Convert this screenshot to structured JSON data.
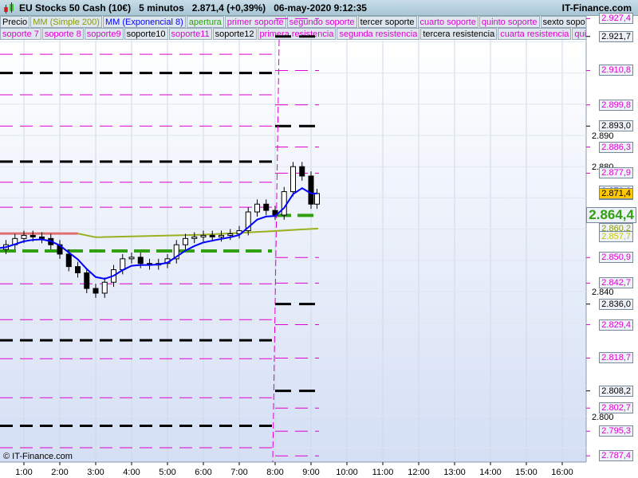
{
  "header": {
    "title": "EU Stocks 50 Cash (10€)",
    "timeframe": "5 minutos",
    "price": "2.871,4 (+0,39%)",
    "datetime": "06-may-2020 9:12:35",
    "brand": "IT-Finance.com"
  },
  "legend_row1": [
    {
      "t": "Precio",
      "c": "#000"
    },
    {
      "t": "MM (Simple 200)",
      "c": "#8a9a10"
    },
    {
      "t": "MM (Exponencial 8)",
      "c": "#0000ff"
    },
    {
      "t": "apertura",
      "c": "#30a010"
    },
    {
      "t": "primer soporte",
      "c": "#e000d0"
    },
    {
      "t": "segundo soporte",
      "c": "#e000d0"
    },
    {
      "t": "tercer soporte",
      "c": "#000"
    },
    {
      "t": "cuarto soporte",
      "c": "#e000d0"
    },
    {
      "t": "quinto soporte",
      "c": "#e000d0"
    },
    {
      "t": "sexto soporte",
      "c": "#000"
    }
  ],
  "legend_row2": [
    {
      "t": "soporte 7",
      "c": "#e000d0"
    },
    {
      "t": "soporte 8",
      "c": "#e000d0"
    },
    {
      "t": "soporte9",
      "c": "#e000d0"
    },
    {
      "t": "soporte10",
      "c": "#000"
    },
    {
      "t": "soporte11",
      "c": "#e000d0"
    },
    {
      "t": "soporte12",
      "c": "#000"
    },
    {
      "t": "primera resistencia",
      "c": "#e000d0"
    },
    {
      "t": "segunda resistencia",
      "c": "#e000d0"
    },
    {
      "t": "tercera resistencia",
      "c": "#000"
    },
    {
      "t": "cuarta resistencia",
      "c": "#e000d0"
    },
    {
      "t": "quinta resistencia",
      "c": "#e000d0"
    }
  ],
  "credit": "© IT-Finance.com",
  "chart_data": {
    "type": "candlestick",
    "x_ticks": [
      "1:00",
      "2:00",
      "3:00",
      "4:00",
      "5:00",
      "6:00",
      "7:00",
      "8:00",
      "9:00",
      "10:00",
      "11:00",
      "12:00",
      "13:00",
      "14:00",
      "15:00",
      "16:00"
    ],
    "y_ticks": [
      "2.890",
      "2.880",
      "2.840",
      "2.800"
    ],
    "times": [
      "0:00",
      "0:15",
      "0:30",
      "0:45",
      "1:00",
      "1:15",
      "1:30",
      "1:45",
      "2:00",
      "2:15",
      "2:30",
      "2:45",
      "3:00",
      "3:15",
      "3:30",
      "3:45",
      "4:00",
      "4:15",
      "4:30",
      "4:45",
      "5:00",
      "5:15",
      "5:30",
      "5:45",
      "6:00",
      "6:15",
      "6:30",
      "6:45",
      "7:00",
      "7:15",
      "7:30",
      "7:45",
      "8:00",
      "8:15",
      "8:30",
      "8:45",
      "9:00",
      "9:10"
    ],
    "closes": [
      2854,
      2853.5,
      2855,
      2857,
      2858,
      2857.5,
      2857,
      2855,
      2852,
      2848,
      2846,
      2841,
      2839.5,
      2843,
      2847,
      2850.5,
      2851,
      2849,
      2848.5,
      2849,
      2850.5,
      2855,
      2857,
      2857.5,
      2858,
      2857.5,
      2858,
      2858.5,
      2859.5,
      2865.5,
      2868,
      2866,
      2864.5,
      2872,
      2880,
      2877,
      2868,
      2871.4
    ],
    "sma200": [
      [
        0,
        2858.6
      ],
      [
        2.5,
        2858.6
      ],
      [
        3,
        2857.4
      ],
      [
        6,
        2858.2
      ],
      [
        8,
        2859.4
      ],
      [
        9.2,
        2860.2
      ]
    ],
    "apertura_prev": 2853,
    "apertura": 2864.4,
    "levels_prev": {
      "black": [
        2910,
        2881.6,
        2824.4,
        2797
      ],
      "magenta": [
        2916,
        2903,
        2893,
        2875,
        2867,
        2842.5,
        2831,
        2818.5,
        2806,
        2790
      ]
    },
    "levels_today": [
      {
        "v": 2927.4,
        "label": "2.927,4",
        "c": "#e000d0"
      },
      {
        "v": 2921.7,
        "label": "2.921,7",
        "c": "#000"
      },
      {
        "v": 2910.8,
        "label": "2.910,8",
        "c": "#e000d0"
      },
      {
        "v": 2899.8,
        "label": "2.899,8",
        "c": "#e000d0"
      },
      {
        "v": 2893.0,
        "label": "2.893,0",
        "c": "#000"
      },
      {
        "v": 2886.3,
        "label": "2.886,3",
        "c": "#e000d0"
      },
      {
        "v": 2877.9,
        "label": "2.877,9",
        "c": "#e000d0"
      },
      {
        "v": 2850.9,
        "label": "2.850,9",
        "c": "#e000d0"
      },
      {
        "v": 2842.7,
        "label": "2.842,7",
        "c": "#e000d0"
      },
      {
        "v": 2836.0,
        "label": "2.836,0",
        "c": "#000"
      },
      {
        "v": 2829.4,
        "label": "2.829,4",
        "c": "#e000d0"
      },
      {
        "v": 2818.7,
        "label": "2.818,7",
        "c": "#e000d0"
      },
      {
        "v": 2808.2,
        "label": "2.808,2",
        "c": "#000"
      },
      {
        "v": 2802.7,
        "label": "2.802,7",
        "c": "#e000d0"
      },
      {
        "v": 2795.3,
        "label": "2.795,3",
        "c": "#e000d0"
      },
      {
        "v": 2787.4,
        "label": "2.787,4",
        "c": "#e000d0"
      }
    ],
    "indicator_labels": [
      {
        "v": 2872.2,
        "label": "2.872,2",
        "c": "#0000ff",
        "bg": "#eef2f8"
      },
      {
        "v": 2871.2,
        "label": "2.871,2",
        "c": "#c8c800",
        "bg": "#eef2f8"
      },
      {
        "v": 2871.4,
        "label": "2.871,4",
        "c": "#000",
        "bg": "#ffc800"
      },
      {
        "v": 2864.4,
        "label": "2.864,4",
        "c": "#30a010",
        "bg": "#eef2f8",
        "big": true
      },
      {
        "v": 2860.2,
        "label": "2.860,2",
        "c": "#8a9a10",
        "bg": "#eef2f8"
      },
      {
        "v": 2857.7,
        "label": "2.857,7",
        "c": "#c8c800",
        "bg": "#eef2f8"
      }
    ]
  }
}
